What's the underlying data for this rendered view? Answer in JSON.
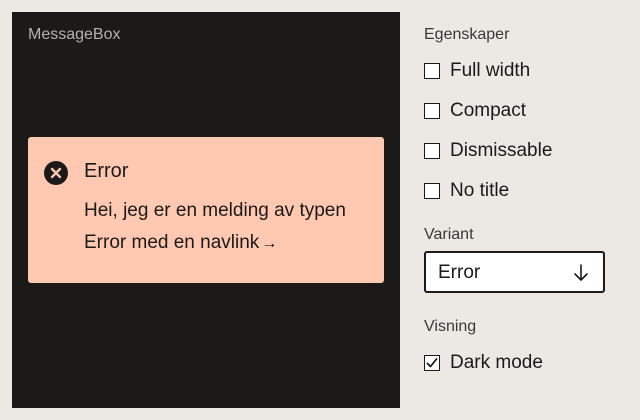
{
  "preview": {
    "title": "MessageBox",
    "message": {
      "variant_icon": "error-x-circle-icon",
      "title": "Error",
      "body_text": "Hei, jeg er en melding av typen Error med en ",
      "link_text": "navlink",
      "link_arrow": "→",
      "background_color": "#ffc8b1"
    }
  },
  "panel": {
    "properties_label": "Egenskaper",
    "options": [
      {
        "label": "Full width",
        "checked": false
      },
      {
        "label": "Compact",
        "checked": false
      },
      {
        "label": "Dismissable",
        "checked": false
      },
      {
        "label": "No title",
        "checked": false
      }
    ],
    "variant_label": "Variant",
    "variant_select": {
      "value": "Error",
      "icon": "arrow-down-icon"
    },
    "display_label": "Visning",
    "dark_mode": {
      "label": "Dark mode",
      "checked": true
    }
  }
}
